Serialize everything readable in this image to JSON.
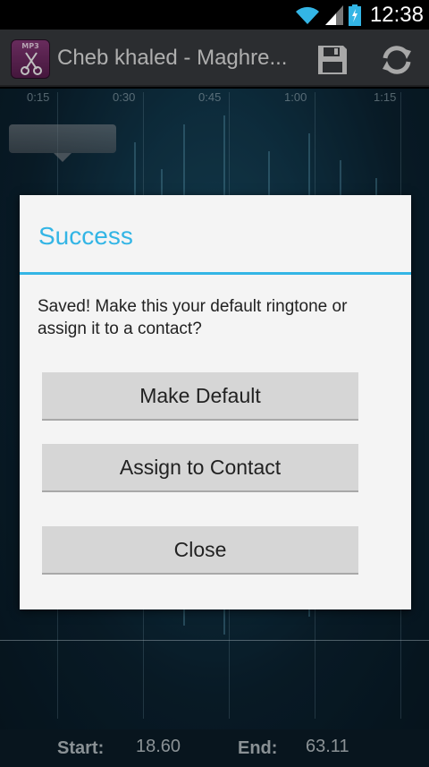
{
  "status_bar": {
    "time": "12:38"
  },
  "action_bar": {
    "app_icon_text": "MP3",
    "title": "Cheb khaled - Maghre..."
  },
  "timeline": {
    "ticks": [
      "0:15",
      "0:30",
      "0:45",
      "1:00",
      "1:15"
    ]
  },
  "bottom": {
    "start_label": "Start:",
    "start_value": "18.60",
    "end_label": "End:",
    "end_value": "63.11"
  },
  "dialog": {
    "title": "Success",
    "message": "Saved! Make this your default ringtone or assign it to a contact?",
    "buttons": {
      "make_default": "Make Default",
      "assign_contact": "Assign to Contact",
      "close": "Close"
    }
  },
  "colors": {
    "accent": "#33b5e5",
    "dialog_bg": "#f4f4f4",
    "button_bg": "#d6d6d6"
  }
}
